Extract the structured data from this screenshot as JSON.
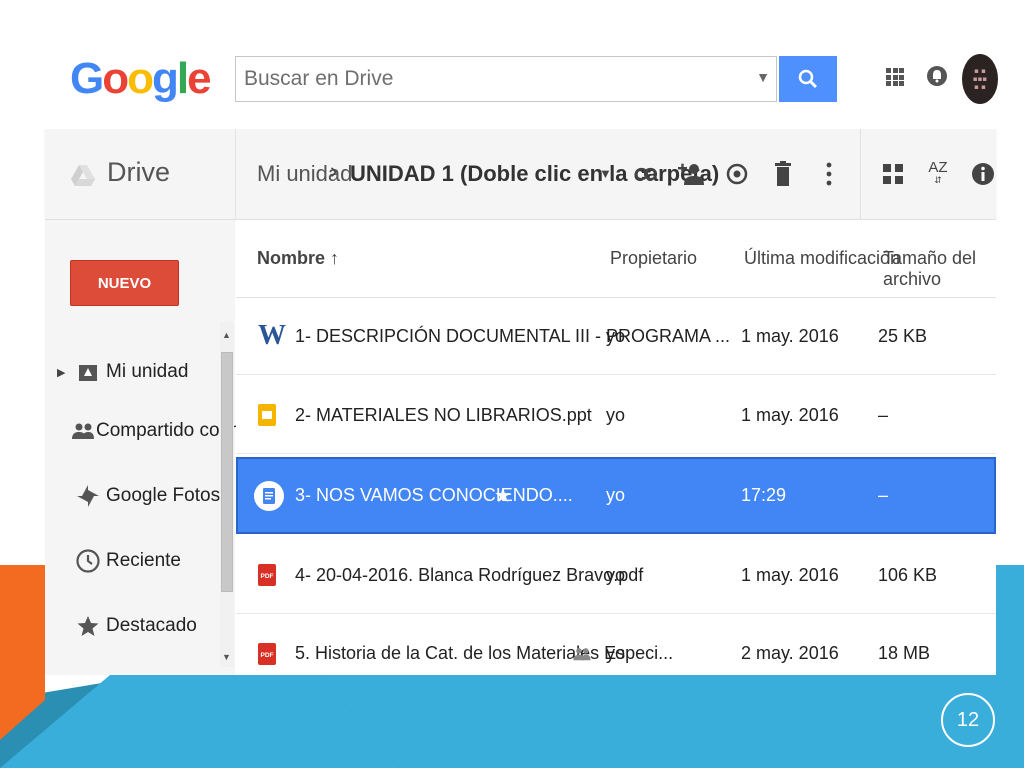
{
  "google": {
    "logo_text": "Google"
  },
  "search": {
    "placeholder": "Buscar en Drive"
  },
  "toolbar": {
    "app_name": "Drive",
    "breadcrumb_root": "Mi unidad",
    "breadcrumb_separator": "›",
    "breadcrumb_current": "UNIDAD 1 (Doble clic en la carpeta)",
    "sort_icon_text": "AZ"
  },
  "sidebar": {
    "new_button": "NUEVO",
    "items": [
      {
        "label": "Mi unidad",
        "icon": "drive-folder-icon"
      },
      {
        "label": "Compartido conmigo",
        "icon": "people-icon"
      },
      {
        "label": "Google Fotos",
        "icon": "pinwheel-icon"
      },
      {
        "label": "Reciente",
        "icon": "clock-icon"
      },
      {
        "label": "Destacado",
        "icon": "star-icon"
      }
    ]
  },
  "list": {
    "columns": {
      "name": "Nombre",
      "sort_arrow": "↑",
      "owner": "Propietario",
      "modified": "Última modificación",
      "size": "Tamaño del archivo"
    },
    "rows": [
      {
        "name": "1- DESCRIPCIÓN DOCUMENTAL III - PROGRAMA ...",
        "owner": "yo",
        "modified": "1 may. 2016",
        "size": "25 KB",
        "type": "word-icon",
        "selected": false
      },
      {
        "name": "2- MATERIALES NO LIBRARIOS.ppt",
        "owner": "yo",
        "modified": "1 may. 2016",
        "size": "–",
        "type": "slides-icon",
        "selected": false
      },
      {
        "name": "3- NOS VAMOS CONOCIENDO....",
        "owner": "yo",
        "modified": "17:29",
        "size": "–",
        "type": "docs-icon",
        "selected": true,
        "starred": true
      },
      {
        "name": "4- 20-04-2016. Blanca Rodríguez Bravo.pdf",
        "owner": "yo",
        "modified": "1 may. 2016",
        "size": "106 KB",
        "type": "pdf-icon",
        "selected": false
      },
      {
        "name": "5. Historia de la Cat. de los Materiales Especi...",
        "owner": "yo",
        "modified": "2 may. 2016",
        "size": "18 MB",
        "type": "pdf-icon",
        "selected": false,
        "shared": true
      }
    ]
  },
  "slide": {
    "page_number": "12"
  },
  "colors": {
    "accent_blue": "#4285f4",
    "new_button_red": "#dd4b39",
    "deco_orange": "#f26b21",
    "deco_blue": "#3aaedb",
    "deco_dark": "#2a8fb3"
  }
}
